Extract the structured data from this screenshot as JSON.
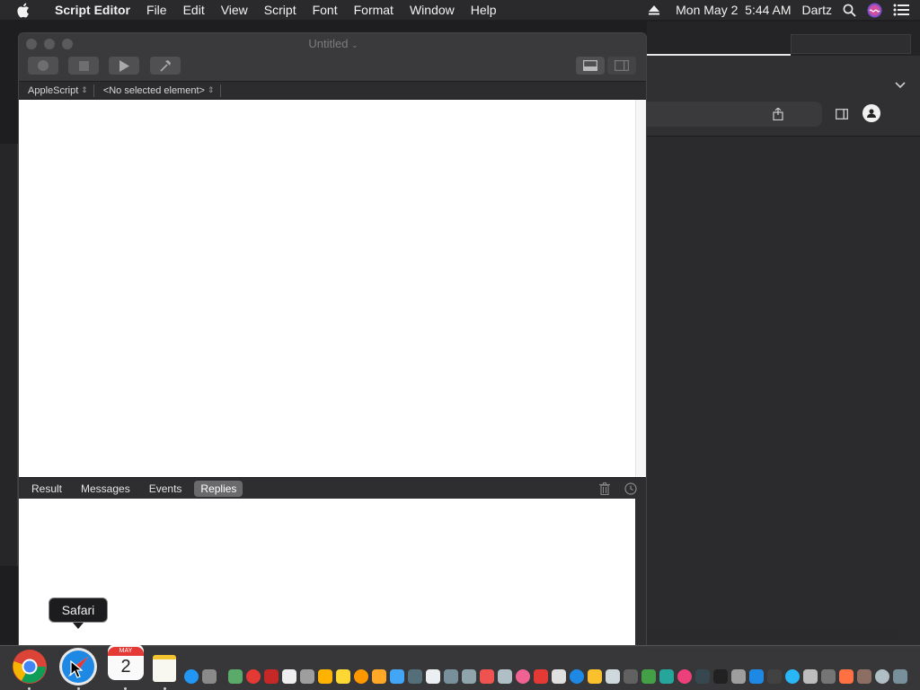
{
  "menubar": {
    "app_name": "Script Editor",
    "menus": [
      "File",
      "Edit",
      "View",
      "Script",
      "Font",
      "Format",
      "Window",
      "Help"
    ],
    "clock": "Mon May 2  5:44 AM",
    "user": "Dartz"
  },
  "editor": {
    "title": "Untitled",
    "language": "AppleScript",
    "element_selector": "<No selected element>",
    "log_tabs": [
      "Result",
      "Messages",
      "Events",
      "Replies"
    ],
    "active_log_tab": "Replies"
  },
  "tooltip": {
    "text": "Safari"
  },
  "dock": {
    "calendar_month": "MAY",
    "calendar_day": "2",
    "colors": {
      "chrome_red": "#db4437",
      "chrome_yellow": "#f4b400",
      "chrome_green": "#0f9d58",
      "safari_blue": "#1e88e5"
    }
  }
}
